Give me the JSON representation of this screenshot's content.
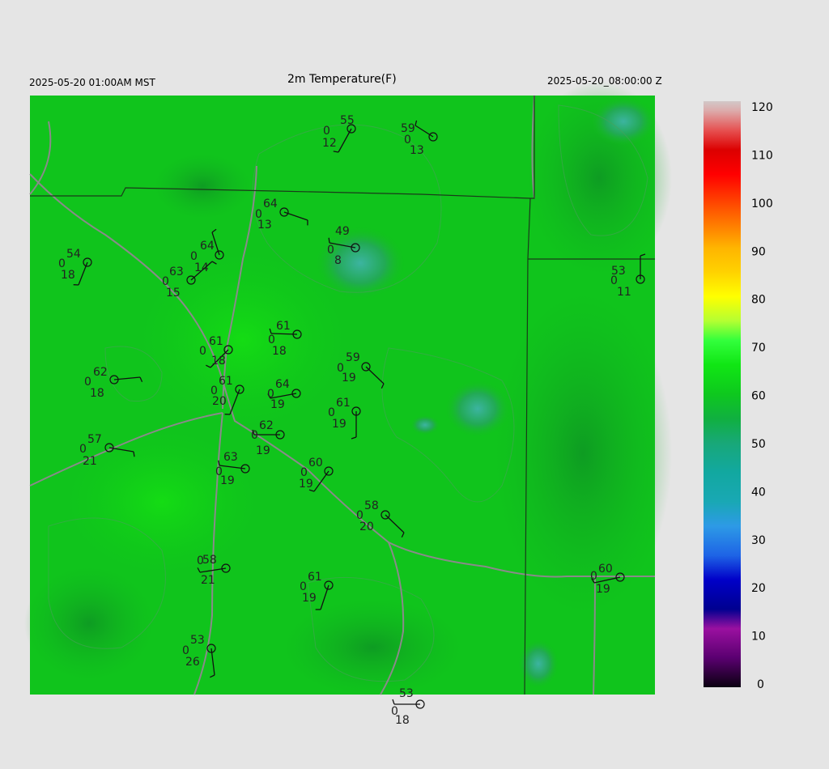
{
  "header": {
    "local_time": "2025-05-20 01:00AM MST",
    "title": "2m Temperature(F)",
    "valid_time": "2025-05-20_08:00:00 Z"
  },
  "colorbar": {
    "labels": [
      "120",
      "110",
      "100",
      "90",
      "80",
      "70",
      "60",
      "50",
      "40",
      "30",
      "20",
      "10",
      "0"
    ],
    "stops": [
      {
        "value": 0,
        "color": "#0a0010"
      },
      {
        "value": 6,
        "color": "#5a0070"
      },
      {
        "value": 12,
        "color": "#9a10a0"
      },
      {
        "value": 16,
        "color": "#000090"
      },
      {
        "value": 22,
        "color": "#0000c8"
      },
      {
        "value": 27,
        "color": "#1e64e6"
      },
      {
        "value": 33,
        "color": "#2d9ae6"
      },
      {
        "value": 38,
        "color": "#19a8b4"
      },
      {
        "value": 44,
        "color": "#12a8a0"
      },
      {
        "value": 50,
        "color": "#18a878"
      },
      {
        "value": 55,
        "color": "#10b040"
      },
      {
        "value": 60,
        "color": "#0ec81e"
      },
      {
        "value": 66,
        "color": "#10e614"
      },
      {
        "value": 71,
        "color": "#32ff3c"
      },
      {
        "value": 75,
        "color": "#b4ff32"
      },
      {
        "value": 80,
        "color": "#ffff00"
      },
      {
        "value": 85,
        "color": "#ffd200"
      },
      {
        "value": 90,
        "color": "#ffb400"
      },
      {
        "value": 95,
        "color": "#ff7800"
      },
      {
        "value": 100,
        "color": "#ff3c00"
      },
      {
        "value": 105,
        "color": "#ff0000"
      },
      {
        "value": 110,
        "color": "#dc0000"
      },
      {
        "value": 114,
        "color": "#e65050"
      },
      {
        "value": 118,
        "color": "#dcaaaa"
      },
      {
        "value": 120,
        "color": "#d2c8c8"
      }
    ]
  },
  "stations": [
    {
      "temp": "55",
      "mid": "0",
      "low": "12"
    },
    {
      "temp": "59",
      "mid": "0",
      "low": "13"
    },
    {
      "temp": "64",
      "mid": "0",
      "low": "13"
    },
    {
      "temp": "49",
      "mid": "0",
      "low": "8"
    },
    {
      "temp": "54",
      "mid": "0",
      "low": "18"
    },
    {
      "temp": "64",
      "mid": "0",
      "low": "14"
    },
    {
      "temp": "63",
      "mid": "0",
      "low": "15"
    },
    {
      "temp": "53",
      "mid": "0",
      "low": "11"
    },
    {
      "temp": "61",
      "mid": "0",
      "low": "18"
    },
    {
      "temp": "61",
      "mid": "0",
      "low": "18"
    },
    {
      "temp": "59",
      "mid": "0",
      "low": "19"
    },
    {
      "temp": "62",
      "mid": "0",
      "low": "18"
    },
    {
      "temp": "61",
      "mid": "0",
      "low": "20"
    },
    {
      "temp": "64",
      "mid": "0",
      "low": "19"
    },
    {
      "temp": "61",
      "mid": "0",
      "low": "19"
    },
    {
      "temp": "57",
      "mid": "0",
      "low": "21"
    },
    {
      "temp": "62",
      "mid": "0",
      "low": "19"
    },
    {
      "temp": "63",
      "mid": "0",
      "low": "19"
    },
    {
      "temp": "60",
      "mid": "0",
      "low": "19"
    },
    {
      "temp": "58",
      "mid": "0",
      "low": "20"
    },
    {
      "temp": "58",
      "mid": "0",
      "low": "21"
    },
    {
      "temp": "60",
      "mid": "0",
      "low": "19"
    },
    {
      "temp": "61",
      "mid": "0",
      "low": "19"
    },
    {
      "temp": "53",
      "mid": "0",
      "low": "26"
    },
    {
      "temp": "53",
      "mid": "0",
      "low": "18"
    }
  ]
}
